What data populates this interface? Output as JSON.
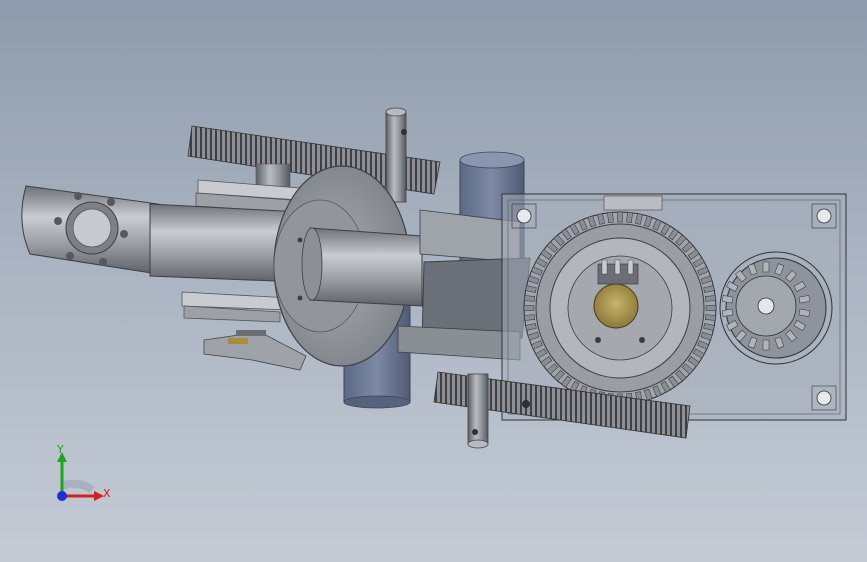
{
  "viewport": {
    "background_top": "#8f9bac",
    "background_bottom": "#c4cbd5"
  },
  "model": {
    "parts": [
      "arm-link",
      "shaft-tube",
      "flange-disc",
      "upper-gear",
      "lower-gear",
      "idler-gear",
      "pinion-gear",
      "mounting-plate",
      "potentiometer",
      "vertical-pin",
      "column",
      "bracket"
    ]
  },
  "triad": {
    "x_label": "X",
    "y_label": "Y",
    "x_color": "#d41f1f",
    "y_color": "#1fa61f",
    "z_color": "#1f2fd4"
  }
}
